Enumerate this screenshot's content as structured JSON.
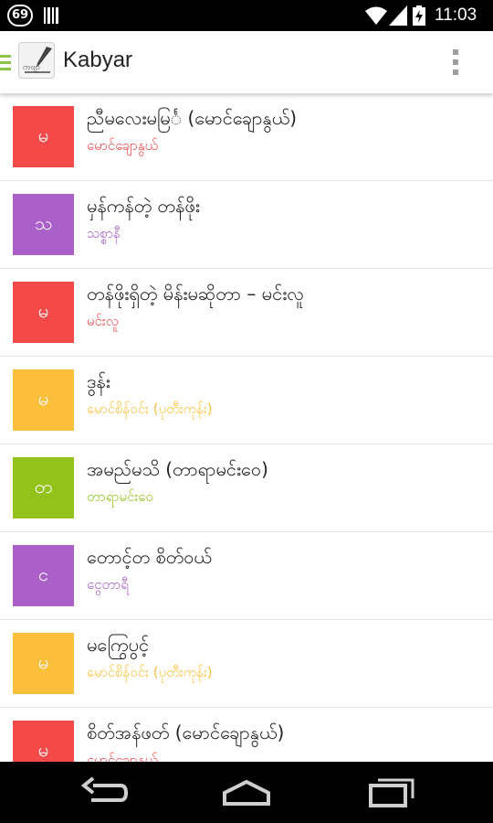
{
  "status_bar": {
    "notification_count": "69",
    "time": "11:03",
    "icons": [
      "barcode-icon",
      "wifi-icon",
      "signal-icon",
      "battery-charging-icon"
    ]
  },
  "action_bar": {
    "title": "Kabyar",
    "logo_text": "ကဗျာ",
    "icons": [
      "drawer-icon",
      "app-logo-icon",
      "overflow-menu-icon"
    ]
  },
  "poems": [
    {
      "initial": "မ",
      "title": "ညီမလေးမမြင်္ (မောင်ချောနွယ်)",
      "author": "မောင်ချောနွယ်",
      "color": "#f44a4a"
    },
    {
      "initial": "သ",
      "title": "မှန်ကန်တဲ့ တန်ဖိုး",
      "author": "သစ္စာနီ",
      "color": "#aa60c8"
    },
    {
      "initial": "မ",
      "title": "တန်ဖိုးရှိတဲ့ မိန်းမဆိုတာ – မင်းလူ",
      "author": "မင်းလူ",
      "color": "#f44a4a"
    },
    {
      "initial": "မ",
      "title": "ဒွန်း",
      "author": "မောင်စိန်ဝင်း (ပုတီးကုန်း)",
      "color": "#fbbf3b"
    },
    {
      "initial": "တ",
      "title": "အမည်မသိ (တာရာမင်းဝေ)",
      "author": "တာရာမင်းဝေ",
      "color": "#93c21b"
    },
    {
      "initial": "င",
      "title": "တောင့်တ စိတ်ဝယ်",
      "author": "ငွေတာရီ",
      "color": "#aa60c8"
    },
    {
      "initial": "မ",
      "title": "မကြွေပွင့်",
      "author": "မောင်စိန်ဝင်း (ပုတီးကုန်း)",
      "color": "#fbbf3b"
    },
    {
      "initial": "မ",
      "title": "စိတ်အန်ဖတ် (မောင်ချောနွယ်)",
      "author": "မောင်ချောနွယ်",
      "color": "#f44a4a"
    }
  ],
  "nav_bar": {
    "icons": [
      "back-icon",
      "home-icon",
      "recent-apps-icon"
    ]
  }
}
